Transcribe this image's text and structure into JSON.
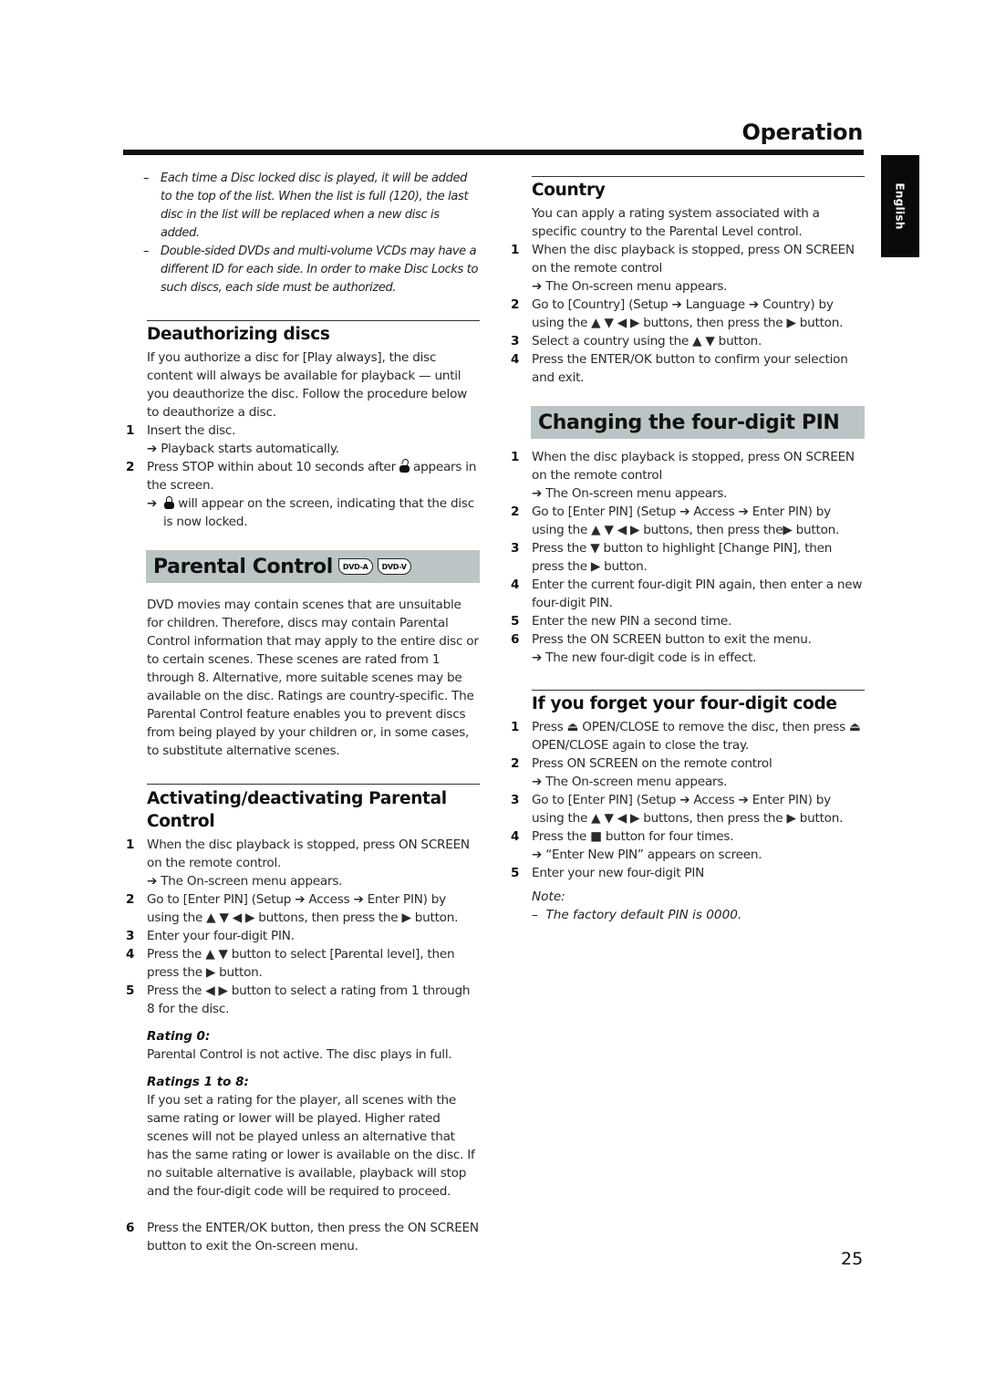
{
  "header": {
    "section_title": "Operation",
    "language_tab": "English"
  },
  "left": {
    "notes": [
      "Each time a Disc locked disc is played, it will be added to the top of the list. When the list is full (120), the last disc in the list will be replaced when a new disc is added.",
      "Double-sided DVDs and multi-volume VCDs may have a different ID for each side. In order to make Disc Locks to such discs, each side must be authorized."
    ],
    "deauthorizing": {
      "heading": "Deauthorizing discs",
      "intro": "If you authorize a disc for [Play always], the disc content will always be available for playback — until you deauthorize the disc. Follow the procedure below to deauthorize a disc.",
      "steps": [
        {
          "num": "1",
          "text": "Insert the disc.",
          "result": "Playback starts automatically."
        },
        {
          "num": "2",
          "text_before_icon": "Press STOP within about 10 seconds after",
          "icon": "unlocked-padlock-icon",
          "text_after_icon": "appears in the screen.",
          "result_icon": "locked-padlock-icon",
          "result": "will appear on the screen, indicating that the disc is now locked."
        }
      ]
    },
    "parental_control": {
      "heading": "Parental Control",
      "badges": [
        "DVD-A",
        "DVD-V"
      ],
      "intro": "DVD movies may contain scenes that are unsuitable for children. Therefore, discs may contain Parental Control information that may apply to the entire disc or to certain scenes. These scenes are rated from 1 through 8. Alternative, more suitable scenes may be available on the disc. Ratings are country-specific. The Parental Control feature enables you to prevent discs from being played by your children or, in some cases, to substitute alternative scenes."
    },
    "activating": {
      "heading": "Activating/deactivating Parental Control",
      "steps": [
        {
          "num": "1",
          "text": "When the disc playback is stopped, press ON SCREEN on the remote control.",
          "result": "The On-screen menu appears."
        },
        {
          "num": "2",
          "text": "Go to [Enter PIN] (Setup ➔ Access ➔ Enter PIN) by using the ▲ ▼ ◀ ▶ buttons, then press the ▶ button."
        },
        {
          "num": "3",
          "text": "Enter your four-digit PIN."
        },
        {
          "num": "4",
          "text": "Press the ▲ ▼ button to select [Parental level], then press the ▶ button."
        },
        {
          "num": "5",
          "text": "Press the ◀ ▶ button to select a rating from 1 through 8 for the disc."
        }
      ],
      "rating0_label": "Rating 0:",
      "rating0_text": "Parental Control is not active. The disc plays in full.",
      "ratings18_label": "Ratings 1 to 8:",
      "ratings18_text": "If you set a rating for the player, all scenes with the same rating or lower will be played. Higher rated scenes will not be played unless an alternative that has the same rating or lower is available on the disc. If no suitable alternative is available, playback will stop and the four-digit code will be required to proceed.",
      "step6": {
        "num": "6",
        "text": "Press the ENTER/OK button, then press the ON SCREEN button to exit the On-screen menu."
      }
    }
  },
  "right": {
    "country": {
      "heading": "Country",
      "intro": "You can apply a rating system associated with a specific country to the Parental Level control.",
      "steps": [
        {
          "num": "1",
          "text": "When the disc playback is stopped, press ON SCREEN on the remote control",
          "result": "The On-screen menu appears."
        },
        {
          "num": "2",
          "text": "Go to [Country] (Setup ➔ Language ➔ Country) by using the ▲ ▼ ◀ ▶ buttons, then press the ▶ button."
        },
        {
          "num": "3",
          "text": "Select a country using the ▲ ▼ button."
        },
        {
          "num": "4",
          "text": "Press the ENTER/OK button to confirm your selection and exit."
        }
      ]
    },
    "change_pin": {
      "heading": "Changing the four-digit PIN",
      "steps": [
        {
          "num": "1",
          "text": "When the disc playback is stopped, press ON SCREEN on the remote control",
          "result": "The On-screen menu appears."
        },
        {
          "num": "2",
          "text": "Go to [Enter PIN] (Setup ➔ Access ➔ Enter PIN) by using the ▲ ▼ ◀ ▶ buttons, then press the▶ button."
        },
        {
          "num": "3",
          "text": "Press the ▼ button to highlight [Change PIN], then press the ▶ button."
        },
        {
          "num": "4",
          "text": "Enter the current four-digit PIN again, then enter a new four-digit PIN."
        },
        {
          "num": "5",
          "text": "Enter the new PIN a second time."
        },
        {
          "num": "6",
          "text": "Press the ON SCREEN button to exit the menu.",
          "result": "The new four-digit code is in effect."
        }
      ]
    },
    "forget_code": {
      "heading": "If you forget your four-digit code",
      "steps": [
        {
          "num": "1",
          "text": "Press ⏏ OPEN/CLOSE to remove the disc, then press ⏏ OPEN/CLOSE again to close the tray."
        },
        {
          "num": "2",
          "text": "Press ON SCREEN on the remote control",
          "result": "The On-screen menu appears."
        },
        {
          "num": "3",
          "text": "Go to [Enter PIN] (Setup ➔ Access ➔ Enter PIN) by using the ▲ ▼ ◀ ▶ buttons, then press the ▶ button."
        },
        {
          "num": "4",
          "text": "Press the ■ button for four times.",
          "result": "“Enter New PIN” appears on screen."
        },
        {
          "num": "5",
          "text": "Enter your new four-digit PIN"
        }
      ],
      "note_label": "Note:",
      "note_text": "The factory default PIN is 0000."
    }
  },
  "footer": {
    "page_number": "25"
  },
  "symbols": {
    "arrow": "➔",
    "dash": "–"
  }
}
